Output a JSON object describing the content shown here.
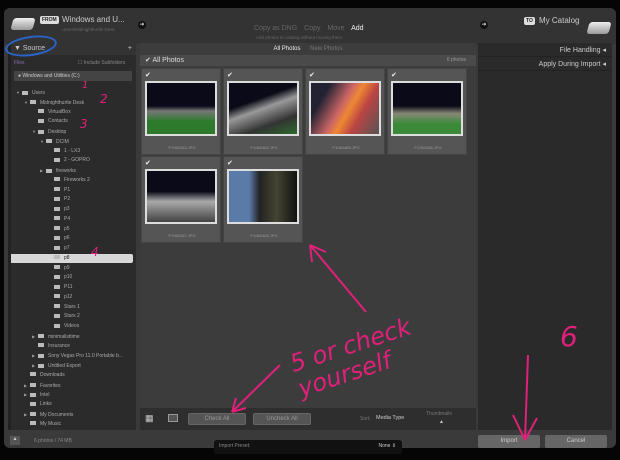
{
  "header": {
    "from_badge": "FROM",
    "source_name": "Windows and U...",
    "source_path": "Users\\Midnighthurtle Desk",
    "modes": [
      "Copy as DNG",
      "Copy",
      "Move",
      "Add"
    ],
    "active_mode": "Add",
    "mode_desc": "Add photos to catalog without moving them",
    "to_badge": "TO",
    "dest_name": "My Catalog"
  },
  "source": {
    "title": "Source",
    "files_label": "Files",
    "include_sub": "Include Subfolders",
    "drive": "Windows and Utilities (C:)",
    "tree": [
      {
        "l": "Users",
        "d": 0,
        "t": "▼"
      },
      {
        "l": "Midnighthurtle Desk",
        "d": 1,
        "t": "▼"
      },
      {
        "l": "VirtualBox",
        "d": 2
      },
      {
        "l": "Contacts",
        "d": 2
      },
      {
        "l": "Desktop",
        "d": 2,
        "t": "▼"
      },
      {
        "l": "DCIM",
        "d": 3,
        "t": "▼"
      },
      {
        "l": "1 - LX3",
        "d": 4
      },
      {
        "l": "2 - GOPRO",
        "d": 4
      },
      {
        "l": "fireworks",
        "d": 3,
        "t": "▶"
      },
      {
        "l": "Fireworks 2",
        "d": 4
      },
      {
        "l": "P1",
        "d": 4
      },
      {
        "l": "P2",
        "d": 4
      },
      {
        "l": "p3",
        "d": 4
      },
      {
        "l": "P4",
        "d": 4
      },
      {
        "l": "p5",
        "d": 4
      },
      {
        "l": "p6",
        "d": 4
      },
      {
        "l": "p7",
        "d": 4
      },
      {
        "l": "p8",
        "d": 4,
        "sel": true
      },
      {
        "l": "p9",
        "d": 4
      },
      {
        "l": "p10",
        "d": 4
      },
      {
        "l": "P11",
        "d": 4
      },
      {
        "l": "p12",
        "d": 4
      },
      {
        "l": "Stars 1",
        "d": 4
      },
      {
        "l": "Stars 2",
        "d": 4
      },
      {
        "l": "Videos",
        "d": 4
      },
      {
        "l": "minimalisttime",
        "d": 2,
        "t": "▶"
      },
      {
        "l": "Insurance",
        "d": 2
      },
      {
        "l": "Sony Vegas Pro 11.0 Portable b...",
        "d": 2,
        "t": "▶"
      },
      {
        "l": "Untitled Export",
        "d": 2,
        "t": "▶"
      },
      {
        "l": "Downloads",
        "d": 1
      },
      {
        "l": "Favorites",
        "d": 1,
        "t": "▶"
      },
      {
        "l": "Intel",
        "d": 1,
        "t": "▶"
      },
      {
        "l": "Links",
        "d": 1
      },
      {
        "l": "My Documents",
        "d": 1,
        "t": "▶"
      },
      {
        "l": "My Music",
        "d": 1
      }
    ]
  },
  "grid": {
    "tabs": [
      "All Photos",
      "New Photos"
    ],
    "header": "All Photos",
    "sort_hint": "6 photos",
    "photos": [
      {
        "name": "P1060483.JPG",
        "bg": "linear-gradient(#0a0a18 45%,#777 55%,#2d7a2d 75%)"
      },
      {
        "name": "P1060484.JPG",
        "bg": "linear-gradient(160deg,#0a0a18 35%,#999 50%,#333 75%,#2d6a2d)"
      },
      {
        "name": "P1060485.JPG",
        "bg": "linear-gradient(120deg,#223 20%,#c66 45%,#e83 55%,#b44 70%,#555)"
      },
      {
        "name": "P1060486.JPG",
        "bg": "linear-gradient(#0a0a18 45%,#887 60%,#3a8a3a 80%)"
      },
      {
        "name": "P1060487.JPG",
        "bg": "linear-gradient(#0a0a18 40%,#aaa 60%,#444)"
      },
      {
        "name": "P1060488.JPG",
        "bg": "linear-gradient(90deg,#5a7aa8 30%,#222 45%,#443 70%,#111)"
      }
    ]
  },
  "toolbar": {
    "check_all": "Check All",
    "uncheck_all": "Uncheck All",
    "sort_label": "Sort:",
    "sort_value": "Media Type",
    "thumb_label": "Thumbnails"
  },
  "right": {
    "sections": [
      "File Handling",
      "Apply During Import"
    ]
  },
  "footer": {
    "summary": "6 photos / 74 MB",
    "preset_label": "Import Preset:",
    "preset_value": "None",
    "import": "Import",
    "cancel": "Cancel"
  },
  "annotations": [
    "1",
    "2",
    "3",
    "4",
    "5 or check yourself",
    "6"
  ]
}
